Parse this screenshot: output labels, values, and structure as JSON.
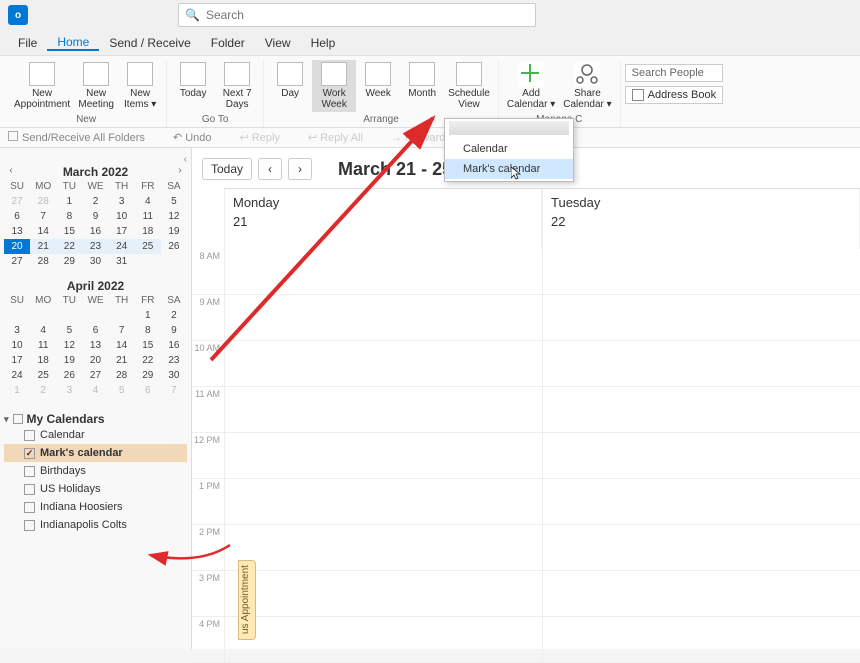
{
  "titlebar": {
    "logo": "o⃕",
    "search_placeholder": "Search"
  },
  "menubar": {
    "items": [
      "File",
      "Home",
      "Send / Receive",
      "Folder",
      "View",
      "Help"
    ],
    "active": 1
  },
  "ribbon": {
    "new": {
      "label": "New",
      "btns": [
        {
          "l1": "New",
          "l2": "Appointment"
        },
        {
          "l1": "New",
          "l2": "Meeting"
        },
        {
          "l1": "New",
          "l2": "Items ▾"
        }
      ]
    },
    "goto": {
      "label": "Go To",
      "btns": [
        {
          "l1": "Today",
          "l2": ""
        },
        {
          "l1": "Next 7",
          "l2": "Days"
        }
      ]
    },
    "arrange": {
      "label": "Arrange",
      "btns": [
        {
          "l1": "Day",
          "l2": ""
        },
        {
          "l1": "Work",
          "l2": "Week"
        },
        {
          "l1": "Week",
          "l2": ""
        },
        {
          "l1": "Month",
          "l2": ""
        },
        {
          "l1": "Schedule",
          "l2": "View"
        }
      ],
      "selected": 1
    },
    "manage": {
      "label": "Manage C",
      "btns": [
        {
          "l1": "Add",
          "l2": "Calendar ▾"
        },
        {
          "l1": "Share",
          "l2": "Calendar ▾"
        }
      ]
    },
    "find": {
      "search": "Search People",
      "addr": "Address Book"
    }
  },
  "qa": {
    "sr": "Send/Receive All Folders",
    "undo": "Undo",
    "reply": "Reply",
    "replyall": "Reply All",
    "forward": "Forward"
  },
  "leftpane": {
    "month1_title": "March 2022",
    "dow": [
      "SU",
      "MO",
      "TU",
      "WE",
      "TH",
      "FR",
      "SA"
    ],
    "m1": [
      [
        "27d",
        "28d",
        "1",
        "2",
        "3",
        "4",
        "5"
      ],
      [
        "6",
        "7",
        "8",
        "9",
        "10",
        "11",
        "12"
      ],
      [
        "13",
        "14",
        "15",
        "16",
        "17",
        "18",
        "19"
      ],
      [
        "20T",
        "21W",
        "22W",
        "23W",
        "24W",
        "25W",
        "26"
      ],
      [
        "27",
        "28",
        "29",
        "30",
        "31",
        "",
        ""
      ]
    ],
    "month2_title": "April 2022",
    "m2": [
      [
        "",
        "",
        "",
        "",
        "",
        "1",
        "2"
      ],
      [
        "3",
        "4",
        "5",
        "6",
        "7",
        "8",
        "9"
      ],
      [
        "10",
        "11",
        "12",
        "13",
        "14",
        "15",
        "16"
      ],
      [
        "17",
        "18",
        "19",
        "20",
        "21",
        "22",
        "23"
      ],
      [
        "24",
        "25",
        "26",
        "27",
        "28",
        "29",
        "30"
      ],
      [
        "1d",
        "2d",
        "3d",
        "4d",
        "5d",
        "6d",
        "7d"
      ]
    ],
    "mycals_title": "My Calendars",
    "cal_items": [
      {
        "label": "Calendar",
        "checked": false,
        "sel": false
      },
      {
        "label": "Mark's calendar",
        "checked": true,
        "sel": true
      },
      {
        "label": "Birthdays",
        "checked": false,
        "sel": false
      },
      {
        "label": "US Holidays",
        "checked": false,
        "sel": false
      },
      {
        "label": "Indiana Hoosiers",
        "checked": false,
        "sel": false
      },
      {
        "label": "Indianapolis Colts",
        "checked": false,
        "sel": false
      }
    ]
  },
  "dropdown": {
    "items": [
      "Calendar",
      "Mark's calendar"
    ],
    "hover": 1
  },
  "rightpane": {
    "today_btn": "Today",
    "range": "March 21 - 25, 2022",
    "days": [
      {
        "name": "Monday",
        "num": "21"
      },
      {
        "name": "Tuesday",
        "num": "22"
      }
    ],
    "times": [
      "8 AM",
      "9 AM",
      "10 AM",
      "11 AM",
      "12 PM",
      "1 PM",
      "2 PM",
      "3 PM",
      "4 PM"
    ],
    "apt_tab": "us Appointment"
  }
}
